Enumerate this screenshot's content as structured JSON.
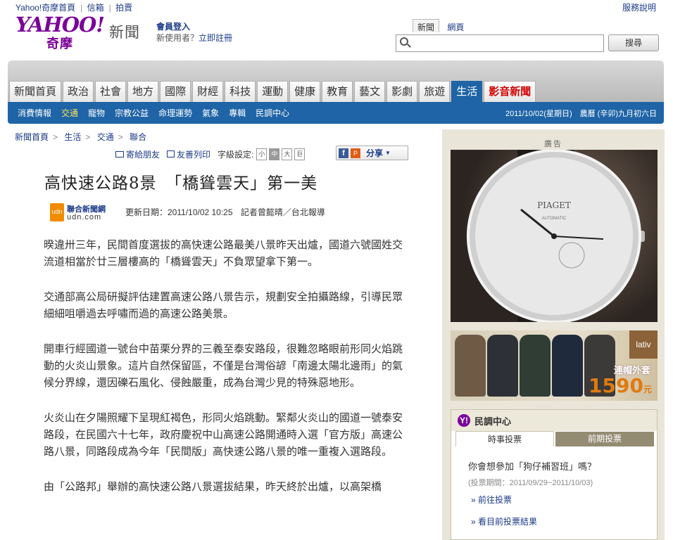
{
  "top_links": [
    "Yahoo!奇摩首頁",
    "信箱",
    "拍賣"
  ],
  "help": "服務說明",
  "logo": {
    "yahoo": "YAHOO!",
    "cn": "奇摩"
  },
  "section_name": "新聞",
  "member": {
    "login": "會員登入",
    "new_user": "新使用者？",
    "register": "立即註冊"
  },
  "search": {
    "tab_news": "新聞",
    "tab_web": "網頁",
    "value": "",
    "button": "搜尋"
  },
  "nav_tabs": [
    {
      "label": "新聞首頁"
    },
    {
      "label": "政治"
    },
    {
      "label": "社會"
    },
    {
      "label": "地方"
    },
    {
      "label": "國際"
    },
    {
      "label": "財經"
    },
    {
      "label": "科技"
    },
    {
      "label": "運動"
    },
    {
      "label": "健康"
    },
    {
      "label": "教育"
    },
    {
      "label": "藝文"
    },
    {
      "label": "影劇"
    },
    {
      "label": "旅遊"
    },
    {
      "label": "生活",
      "active": true
    },
    {
      "label": "影音新聞",
      "video": true
    }
  ],
  "sub_nav": [
    "消費情報",
    "交通",
    "寵物",
    "宗教公益",
    "命理運勢",
    "氣象",
    "專輯",
    "民調中心"
  ],
  "sub_nav_active": "交通",
  "date_line": "2011/10/02(星期日)　農曆 (辛卯)九月初六日",
  "breadcrumb": [
    "新聞首頁",
    "生活",
    "交通",
    "聯合"
  ],
  "tools": {
    "email": "寄給朋友",
    "print": "友善列印",
    "font_label": "字級設定:",
    "font_sizes": [
      "小",
      "中",
      "大",
      "巨"
    ],
    "share": "分享"
  },
  "headline": "高快速公路8景　「橋聳雲天」第一美",
  "source": {
    "name": "聯合新聞網",
    "domain": "udn.com",
    "icon_text": "udn"
  },
  "meta": {
    "updated": "更新日期：2011/10/02 10:25",
    "reporter": "記者曾懿晴／台北報導"
  },
  "article": [
    "暌違卅三年，民間首度選拔的高快速公路最美八景昨天出爐，國道六號國姓交流道相當於廿三層樓高的「橋聳雲天」不負眾望拿下第一。",
    "交通部高公局研擬評估建置高速公路八景告示，規劃安全拍攝路線，引導民眾細細咀嚼過去呼嘯而過的高速公路美景。",
    "開車行經國道一號台中苗栗分界的三義至泰安路段，很難忽略眼前形同火焰跳動的火炎山景象。這片自然保留區，不僅是台灣俗諺「南邊太陽北邊雨」的氣候分界線，還因礫石風化、侵蝕嚴重，成為台灣少見的特殊惡地形。",
    "火炎山在夕陽照耀下呈現紅褐色，形同火焰跳動。緊鄰火炎山的國道一號泰安路段，在民國六十七年，政府慶祝中山高速公路開通時入選「官方版」高速公路八景，同路段成為今年「民間版」高快速公路八景的唯一重複入選路段。",
    "由「公路邦」舉辦的高快速公路八景選拔結果，昨天終於出爐，以高架橋"
  ],
  "ad": {
    "label": "廣告",
    "watch_brand": "PIAGET",
    "watch_text": "AUTOMATIC",
    "banner_brand": "lativ",
    "banner_promo": "連帽外套",
    "banner_price": "1590",
    "banner_unit": "元"
  },
  "poll": {
    "title": "民調中心",
    "tab_current": "時事投票",
    "tab_past": "前期投票",
    "question": "你會想參加「狗仔補習班」嗎？",
    "period": "(投票期間：2011/09/29~2011/10/03)",
    "link_vote": "» 前往投票",
    "link_results": "» 看目前投票結果"
  },
  "colors": {
    "brand_purple": "#7b0099",
    "nav_blue": "#1e64a6",
    "link_blue": "#1b3a87",
    "video_red": "#d40000"
  }
}
